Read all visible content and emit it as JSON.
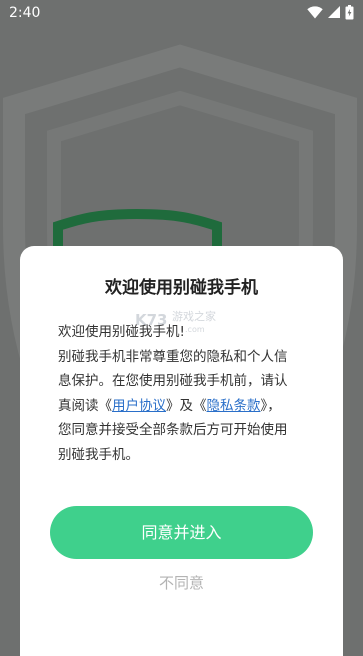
{
  "status_bar": {
    "time": "2:40",
    "icons": [
      "wifi-icon",
      "signal-icon",
      "battery-icon"
    ]
  },
  "dialog": {
    "title": "欢迎使用别碰我手机",
    "greeting": "欢迎使用别碰我手机!",
    "body_lines": [
      "别碰我手机非常尊重您的隐私和个人信",
      "息保护。在您使用别碰我手机前，请认"
    ],
    "line3_prefix": "真阅读《",
    "user_agreement_link": "用户协议",
    "line3_middle": "》及《",
    "privacy_link": "隐私条款",
    "line3_suffix": "》，",
    "body_lines_end": [
      "您同意并接受全部条款后方可开始使用",
      "别碰我手机。"
    ],
    "agree_label": "同意并进入",
    "decline_label": "不同意"
  },
  "watermark": {
    "text": "K73 游戏之家",
    "domain": ".com"
  },
  "colors": {
    "accent_green": "#3fd08c",
    "link_blue": "#2a6fc9",
    "overlay_grey": "#6e706f",
    "shield_green": "#1f6b3c"
  }
}
